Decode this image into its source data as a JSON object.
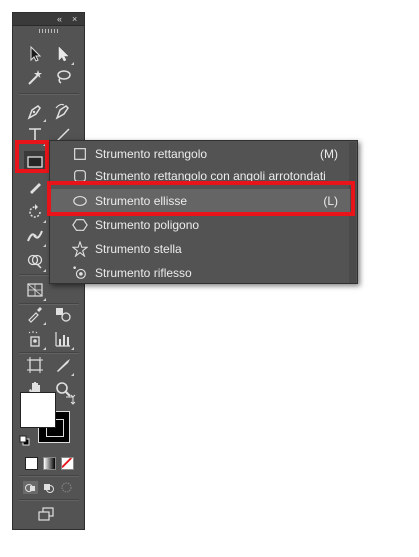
{
  "header": {
    "collapse_glyph": "«",
    "close_glyph": "×"
  },
  "tools": [
    {
      "name": "selection-tool",
      "icon": "arrow-icon"
    },
    {
      "name": "direct-selection-tool",
      "icon": "white-arrow-icon"
    },
    {
      "name": "magic-wand-tool",
      "icon": "magic-wand-icon"
    },
    {
      "name": "lasso-tool",
      "icon": "lasso-icon"
    },
    {
      "name": "pen-tool",
      "icon": "pen-icon"
    },
    {
      "name": "curvature-tool",
      "icon": "pen-curve-icon"
    },
    {
      "name": "type-tool",
      "icon": "type-icon"
    },
    {
      "name": "line-segment-tool",
      "icon": "line-icon"
    },
    {
      "name": "rectangle-tool",
      "icon": "rectangle-icon"
    },
    {
      "name": "pencil-tool",
      "icon": "pencil-icon"
    },
    {
      "name": "rotate-tool",
      "icon": "rotate-icon"
    },
    {
      "name": "width-tool",
      "icon": "width-icon"
    },
    {
      "name": "shape-builder-tool",
      "icon": "shape-builder-icon"
    },
    {
      "name": "perspective-grid-tool",
      "icon": "perspective-icon"
    },
    {
      "name": "eyedropper-tool",
      "icon": "eyedropper-icon"
    },
    {
      "name": "blend-tool",
      "icon": "blend-icon"
    },
    {
      "name": "symbol-sprayer-tool",
      "icon": "symbol-sprayer-icon"
    },
    {
      "name": "column-graph-tool",
      "icon": "column-graph-icon"
    },
    {
      "name": "artboard-tool",
      "icon": "artboard-icon"
    },
    {
      "name": "slice-tool",
      "icon": "slice-icon"
    },
    {
      "name": "hand-tool",
      "icon": "hand-icon"
    },
    {
      "name": "zoom-tool",
      "icon": "zoom-icon"
    }
  ],
  "colors": {
    "panel": "#535353",
    "highlight": "#e8141a",
    "text": "#ececec",
    "fill": "#ffffff",
    "stroke": "#000000",
    "none_slash": "#e8141a"
  },
  "flyout": {
    "items": [
      {
        "icon": "rectangle-icon",
        "label": "Strumento rettangolo",
        "shortcut": "(M)"
      },
      {
        "icon": "rounded-rectangle-icon",
        "label": "Strumento rettangolo con angoli arrotondati",
        "shortcut": ""
      },
      {
        "icon": "ellipse-icon",
        "label": "Strumento ellisse",
        "shortcut": "(L)",
        "selected": true
      },
      {
        "icon": "polygon-icon",
        "label": "Strumento poligono",
        "shortcut": ""
      },
      {
        "icon": "star-icon",
        "label": "Strumento stella",
        "shortcut": ""
      },
      {
        "icon": "flare-icon",
        "label": "Strumento riflesso",
        "shortcut": ""
      }
    ]
  }
}
